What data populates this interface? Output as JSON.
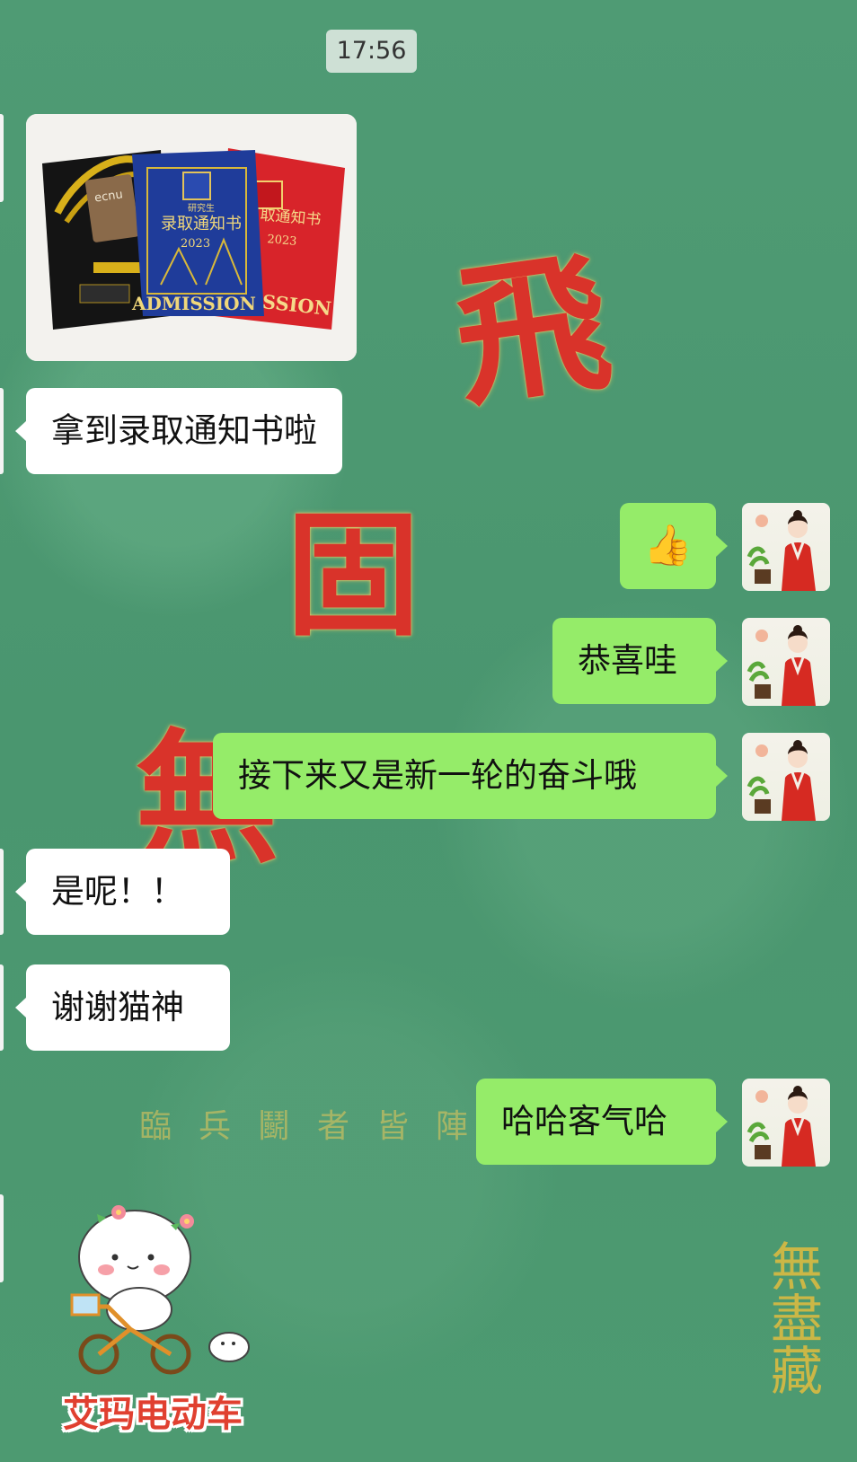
{
  "chat": {
    "timestamp": "17:56",
    "messages": [
      {
        "side": "left",
        "type": "image",
        "image": {
          "badge_text": "ecnu",
          "card_blue_line1": "研究生",
          "card_blue_line2": "录取通知书",
          "card_blue_year": "2023",
          "card_blue_title": "ADMISSION",
          "card_red_line2": "取通知书",
          "card_red_year": "2023",
          "card_red_title": "SSION"
        }
      },
      {
        "side": "left",
        "type": "text",
        "text": "拿到录取通知书啦"
      },
      {
        "side": "right",
        "type": "emoji",
        "text": "👍"
      },
      {
        "side": "right",
        "type": "text",
        "text": "恭喜哇"
      },
      {
        "side": "right",
        "type": "text",
        "text": "接下来又是新一轮的奋斗哦"
      },
      {
        "side": "left",
        "type": "text",
        "text": "是呢！！"
      },
      {
        "side": "left",
        "type": "text",
        "text": "谢谢猫神"
      },
      {
        "side": "right",
        "type": "text",
        "text": "哈哈客气哈"
      },
      {
        "side": "left",
        "type": "sticker",
        "text": "艾玛电动车"
      }
    ]
  },
  "background": {
    "big_chars": [
      "飛",
      "固",
      "無"
    ],
    "gold_line": "臨兵鬭者皆陣",
    "vertical_seal": "無盡藏"
  },
  "colors": {
    "background": "#4e9a72",
    "bubble_right": "#95ec69",
    "bubble_left": "#ffffff"
  },
  "icons": {
    "avatar": "hanfu-woman-avatar",
    "thumbs_up": "thumbs-up-emoji"
  }
}
